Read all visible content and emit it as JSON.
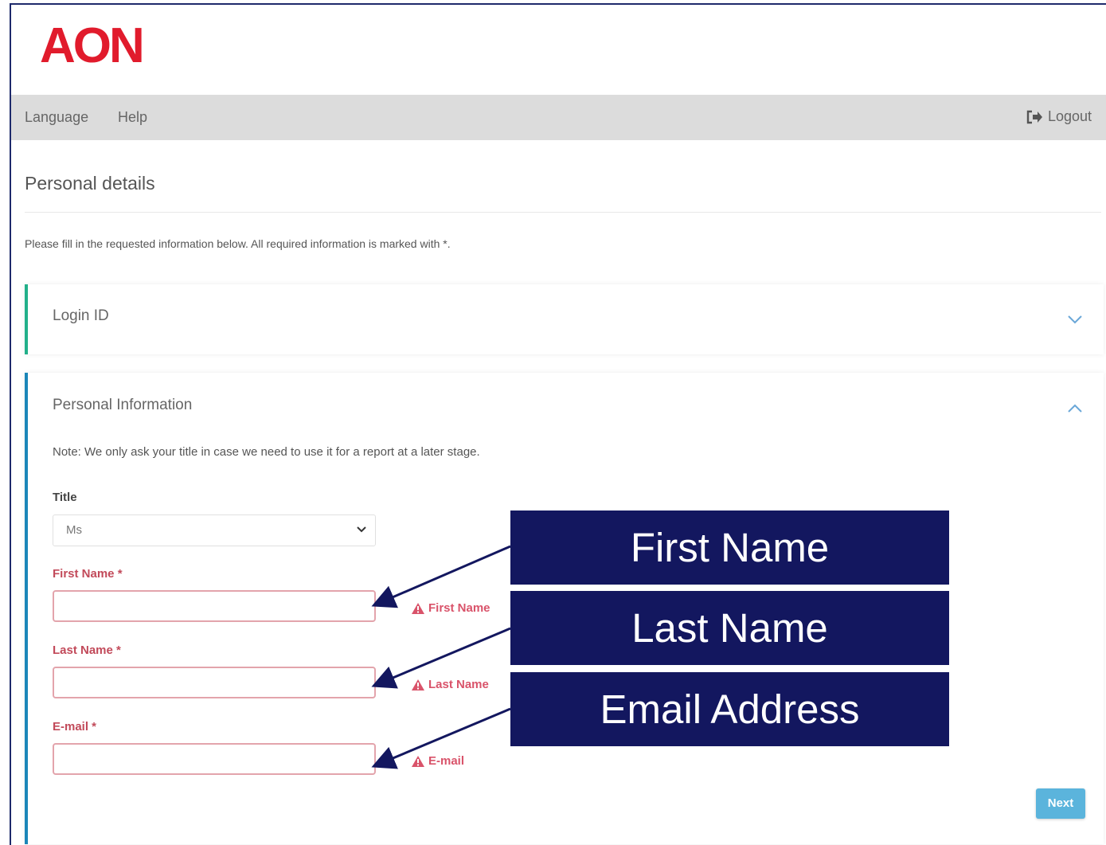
{
  "brand": {
    "logo_text": "AON",
    "logo_color": "#e11b2c"
  },
  "nav": {
    "language": "Language",
    "help": "Help",
    "logout": "Logout"
  },
  "page": {
    "title": "Personal details",
    "instructions": "Please fill in the requested information below. All required information is marked with *."
  },
  "sections": {
    "login": {
      "title": "Login ID",
      "accent": "#22b08a"
    },
    "personal": {
      "title": "Personal Information",
      "accent": "#1b86b8",
      "note": "Note: We only ask your title in case we need to use it for a report at a later stage.",
      "title_label": "Title",
      "title_value": "Ms",
      "first_name_label": "First Name *",
      "first_name_value": "",
      "first_name_error": "First Name",
      "last_name_label": "Last Name *",
      "last_name_value": "",
      "last_name_error": "Last Name",
      "email_label": "E-mail *",
      "email_value": "",
      "email_error": "E-mail",
      "next": "Next"
    }
  },
  "callouts": {
    "first_name": "First Name",
    "last_name": "Last Name",
    "email": "Email Address",
    "color": "#13175f"
  }
}
